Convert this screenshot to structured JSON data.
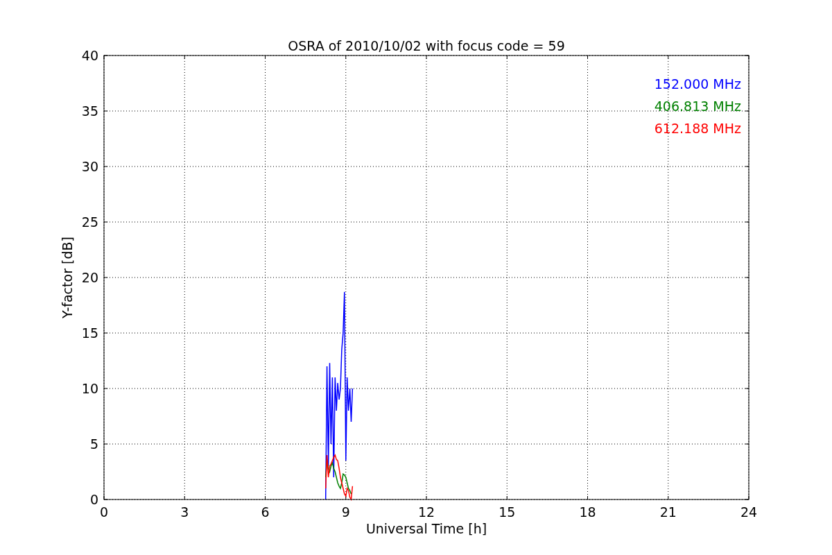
{
  "chart_data": {
    "type": "line",
    "title": "OSRA of 2010/10/02 with focus code = 59",
    "xlabel": "Universal Time [h]",
    "ylabel": "Y-factor [dB]",
    "x": [
      8.25,
      8.3,
      8.35,
      8.4,
      8.45,
      8.5,
      8.55,
      8.6,
      8.65,
      8.7,
      8.75,
      8.8,
      8.85,
      8.9,
      8.95,
      9.0,
      9.05,
      9.1,
      9.15,
      9.2,
      9.25
    ],
    "series": [
      {
        "name": "152.000 MHz",
        "color": "#0000ff",
        "values": [
          0,
          12,
          3,
          12.3,
          5,
          11,
          2,
          11,
          8,
          10.5,
          9,
          10,
          13.5,
          15,
          18.7,
          3.5,
          11,
          8,
          10,
          7,
          10
        ]
      },
      {
        "name": "406.813 MHz",
        "color": "#008000",
        "values": [
          2,
          3.6,
          2.8,
          2.5,
          3,
          3.3,
          2.8,
          2.5,
          2,
          1.5,
          1.2,
          1,
          1.5,
          2.3,
          2.2,
          2,
          1.5,
          1,
          0.8,
          0.5,
          null
        ]
      },
      {
        "name": "612.188 MHz",
        "color": "#ff0000",
        "values": [
          1,
          4,
          2,
          3,
          3.2,
          3.5,
          3.8,
          4,
          3.6,
          3.5,
          2.8,
          2,
          1.5,
          1,
          0.5,
          0.3,
          1,
          0.8,
          0.2,
          0,
          1.2
        ]
      }
    ],
    "xlim": [
      0,
      24
    ],
    "ylim": [
      0,
      40
    ],
    "xticks": [
      0,
      3,
      6,
      9,
      12,
      15,
      18,
      21,
      24
    ],
    "yticks": [
      0,
      5,
      10,
      15,
      20,
      25,
      30,
      35,
      40
    ],
    "grid": true
  }
}
